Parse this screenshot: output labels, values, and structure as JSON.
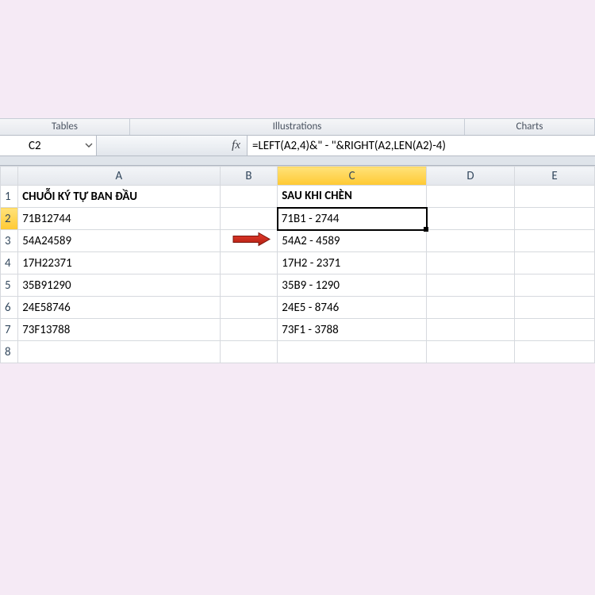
{
  "ribbon": {
    "tables": "Tables",
    "illustrations": "Illustrations",
    "charts": "Charts"
  },
  "nameBox": "C2",
  "fxLabel": "fx",
  "formula": "=LEFT(A2,4)&\" - \"&RIGHT(A2,LEN(A2)-4)",
  "columns": [
    "A",
    "B",
    "C",
    "D",
    "E"
  ],
  "rowNumbers": [
    "1",
    "2",
    "3",
    "4",
    "5",
    "6",
    "7",
    "8"
  ],
  "headers": {
    "A": "CHUỖI KÝ TỰ BAN ĐẦU",
    "C": "SAU KHI CHÈN"
  },
  "rows": [
    {
      "a": "71B12744",
      "c": "71B1 - 2744"
    },
    {
      "a": "54A24589",
      "c": "54A2 - 4589"
    },
    {
      "a": "17H22371",
      "c": "17H2 - 2371"
    },
    {
      "a": "35B91290",
      "c": "35B9 - 1290"
    },
    {
      "a": "24E58746",
      "c": "24E5 - 8746"
    },
    {
      "a": "73F13788",
      "c": "73F1 - 3788"
    }
  ]
}
